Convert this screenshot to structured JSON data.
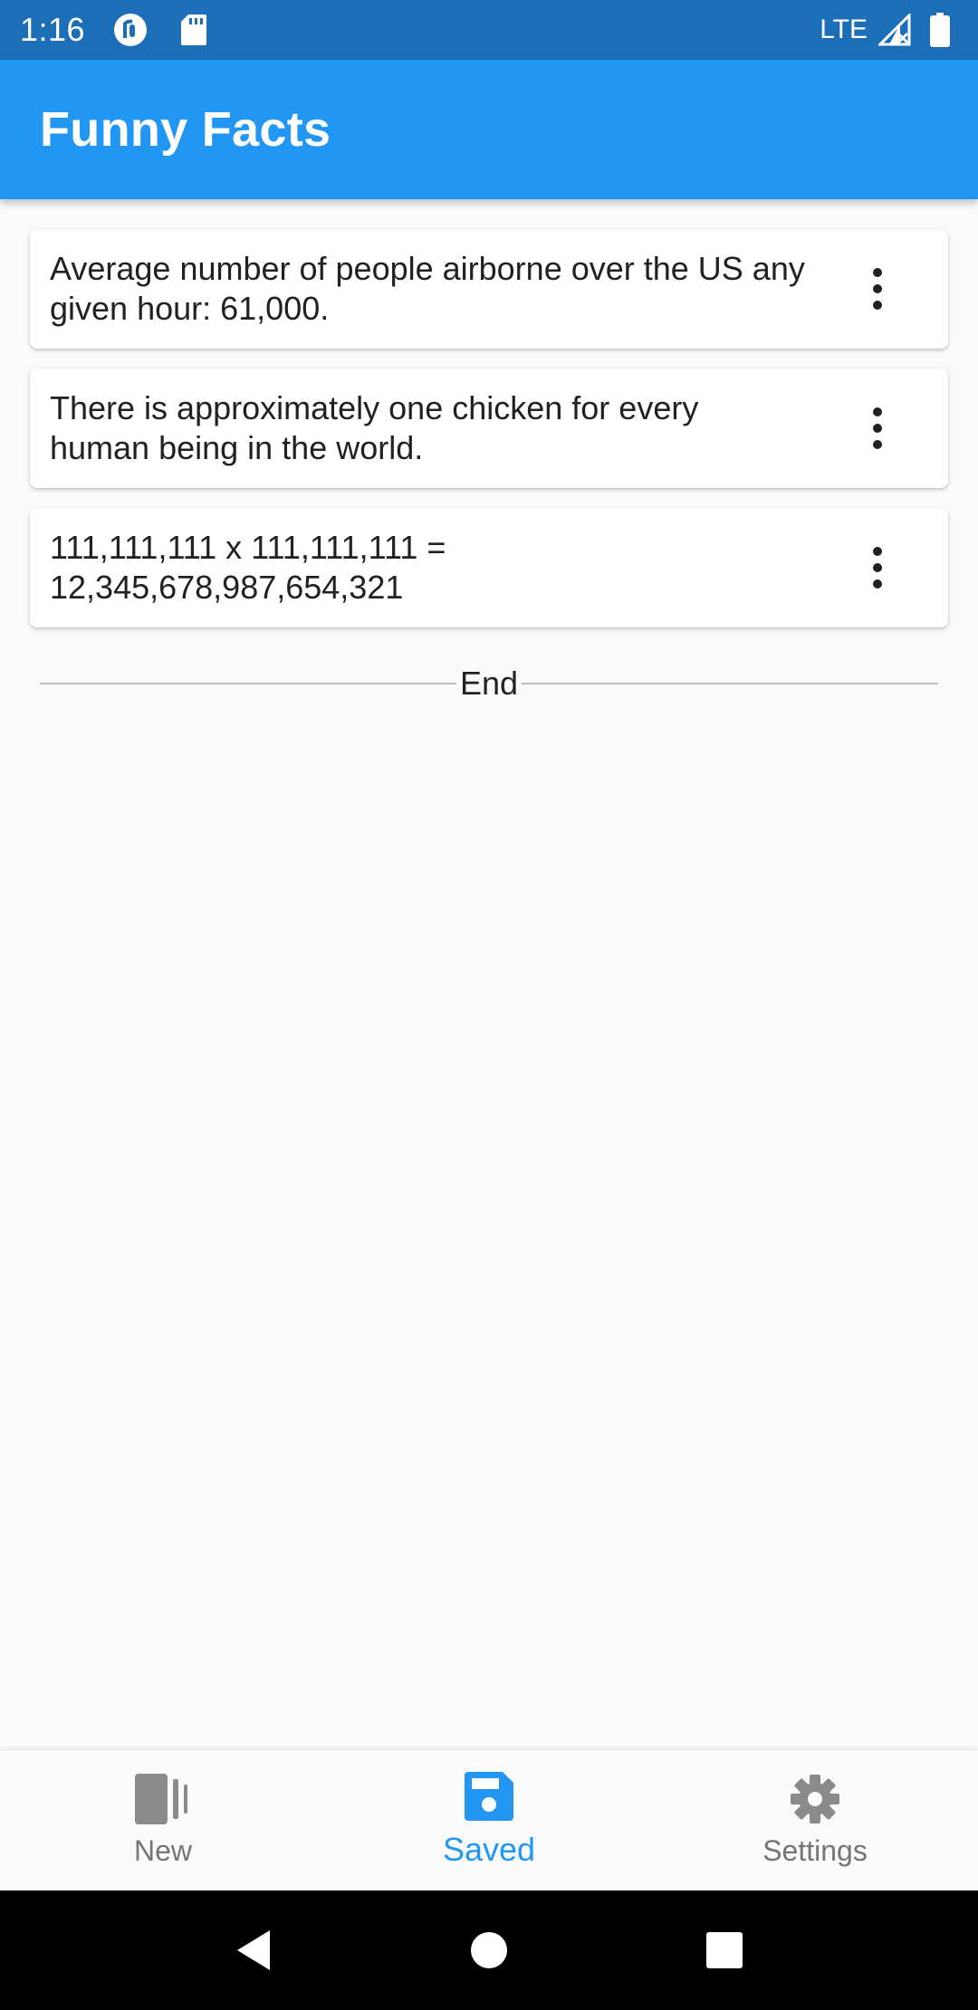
{
  "status_bar": {
    "time": "1:16",
    "network": "LTE",
    "icons": [
      "pocket-casts-icon",
      "sd-card-icon",
      "signal-icon",
      "battery-icon"
    ]
  },
  "app_bar": {
    "title": "Funny Facts"
  },
  "facts": [
    {
      "text": "Average number of people airborne over the US any given hour: 61,000.",
      "menu_icon": "more-vert-icon"
    },
    {
      "text": "There is approximately one chicken for every human being in the world.",
      "menu_icon": "more-vert-icon"
    },
    {
      "text": "111,111,111 x 111,111,111 = 12,345,678,987,654,321",
      "menu_icon": "more-vert-icon"
    }
  ],
  "end_label": "End",
  "bottom_nav": {
    "items": [
      {
        "label": "New",
        "icon": "cards-icon",
        "active": false
      },
      {
        "label": "Saved",
        "icon": "save-icon",
        "active": true
      },
      {
        "label": "Settings",
        "icon": "gear-icon",
        "active": false
      }
    ]
  },
  "system_nav": [
    "back-icon",
    "home-icon",
    "recents-icon"
  ],
  "colors": {
    "primary": "#2196f3",
    "status_bar": "#1c6fb7",
    "inactive": "#757575",
    "background": "#fafafa"
  }
}
